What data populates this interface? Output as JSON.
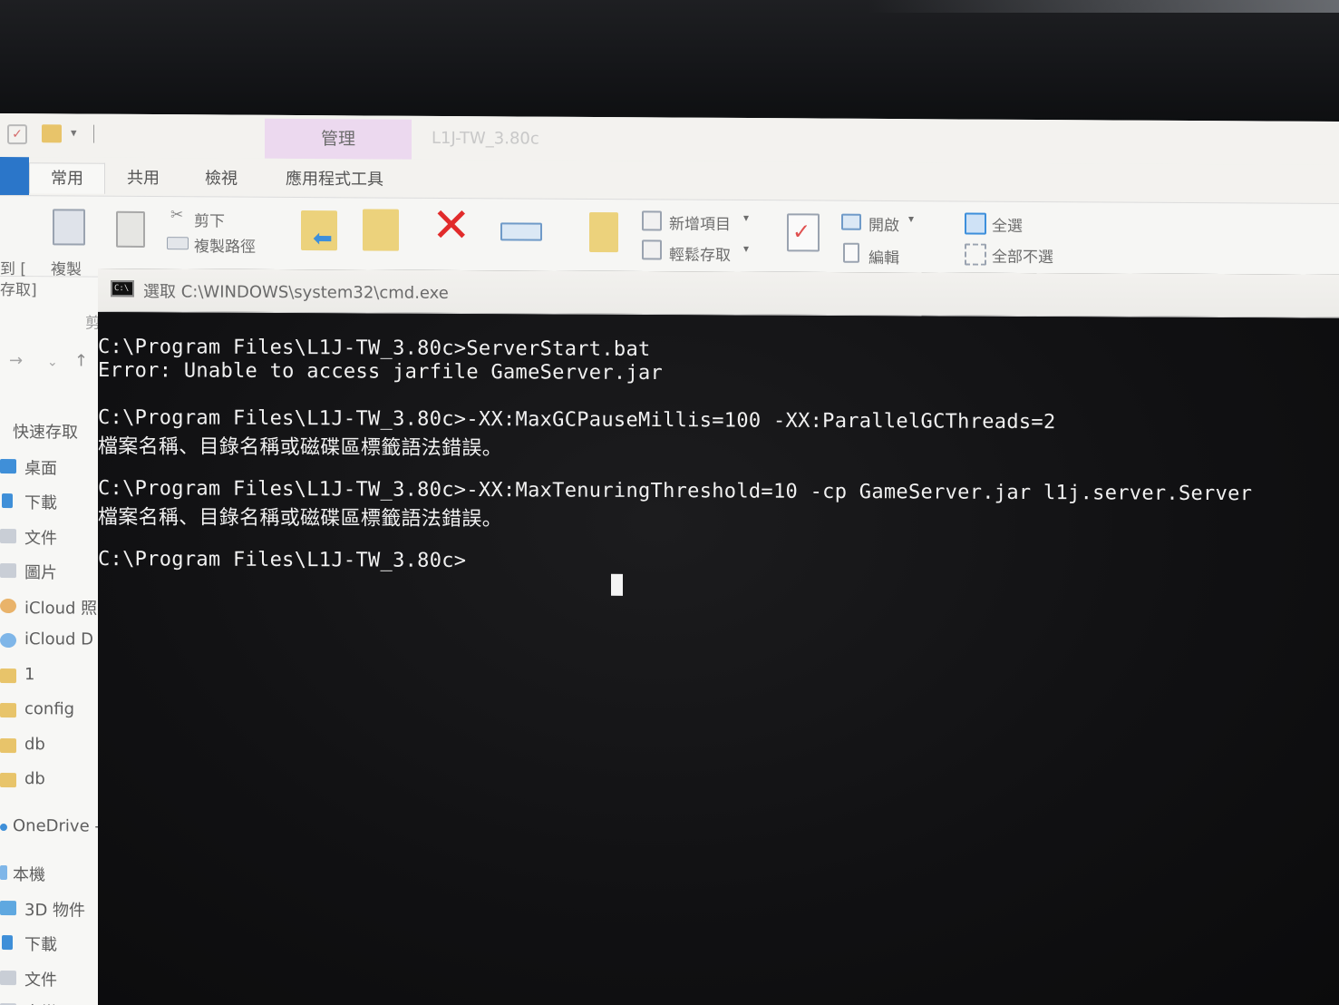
{
  "explorer": {
    "manage_tab": "管理",
    "window_title": "L1J-TW_3.80c",
    "tabs": [
      "常用",
      "共用",
      "檢視",
      "應用程式工具"
    ],
    "ribbon": {
      "pin_label_1": "到 [",
      "pin_label_2": "存取]",
      "copy": "複製",
      "paste": "貼上",
      "cut": "剪下",
      "copy_path": "複製路徑",
      "move_to": "移至",
      "copy_to": "複製到",
      "delete": "刪除",
      "rename": "重新命名",
      "new_folder": "新增",
      "new_item": "新增項目",
      "easy_access": "輕鬆存取",
      "properties": "內容",
      "open": "開啟",
      "edit": "編輯",
      "select_all": "全選",
      "select_none": "全部不選"
    },
    "clipboard_group": "剪",
    "sidebar": [
      {
        "label": "快速存取",
        "color": "#9aa6b8"
      },
      {
        "label": "桌面",
        "color": "#3f8fd8"
      },
      {
        "label": "下載",
        "color": "#3f8fd8"
      },
      {
        "label": "文件",
        "color": "#c9ced6"
      },
      {
        "label": "圖片",
        "color": "#c9ced6"
      },
      {
        "label": "iCloud 照",
        "color": "#e9b36a"
      },
      {
        "label": "iCloud D",
        "color": "#7fb6e8"
      },
      {
        "label": "1",
        "color": "#e8c46a"
      },
      {
        "label": "config",
        "color": "#e8c46a"
      },
      {
        "label": "db",
        "color": "#e8c46a"
      },
      {
        "label": "db",
        "color": "#e8c46a"
      },
      {
        "label": "OneDrive -",
        "color": "#3f8fd8"
      },
      {
        "label": "本機",
        "color": "#7fb6e8"
      },
      {
        "label": "3D 物件",
        "color": "#5fa8e0"
      },
      {
        "label": "下載",
        "color": "#3f8fd8"
      },
      {
        "label": "文件",
        "color": "#c9ced6"
      },
      {
        "label": "音樂",
        "color": "#c9ced6"
      }
    ]
  },
  "cmd": {
    "title": "選取 C:\\WINDOWS\\system32\\cmd.exe",
    "lines": [
      "C:\\Program Files\\L1J-TW_3.80c>ServerStart.bat",
      "Error: Unable to access jarfile GameServer.jar",
      "",
      "C:\\Program Files\\L1J-TW_3.80c>-XX:MaxGCPauseMillis=100 -XX:ParallelGCThreads=2",
      "檔案名稱、目錄名稱或磁碟區標籤語法錯誤。",
      "",
      "C:\\Program Files\\L1J-TW_3.80c>-XX:MaxTenuringThreshold=10 -cp GameServer.jar l1j.server.Server",
      "檔案名稱、目錄名稱或磁碟區標籤語法錯誤。",
      "",
      "C:\\Program Files\\L1J-TW_3.80c>"
    ]
  }
}
